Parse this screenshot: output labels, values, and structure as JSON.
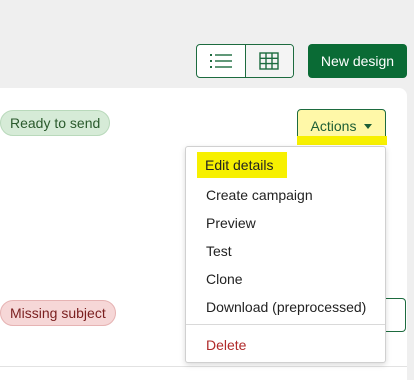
{
  "toolbar": {
    "view_list_icon": "list-icon",
    "view_grid_icon": "grid-icon",
    "new_design_label": "New design",
    "accent_color": "#0a6b35"
  },
  "rows": [
    {
      "status": "Ready to send",
      "status_color": "#d6ebd7"
    },
    {
      "status": "Missing subject",
      "status_color": "#f6d7d7"
    }
  ],
  "actions": {
    "label": "Actions",
    "menu": {
      "items": [
        "Edit details",
        "Create campaign",
        "Preview",
        "Test",
        "Clone",
        "Download (preprocessed)"
      ],
      "danger_item": "Delete",
      "highlighted_item": "Edit details"
    }
  }
}
